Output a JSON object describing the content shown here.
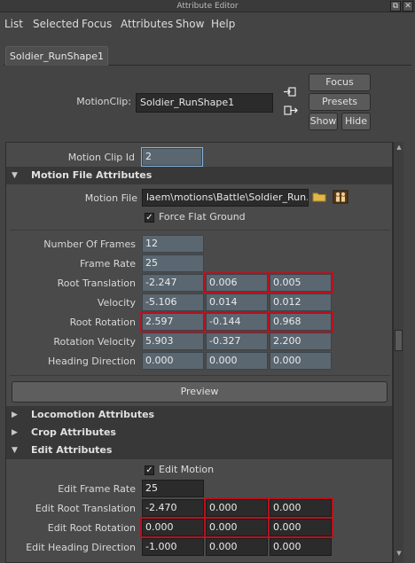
{
  "window": {
    "title": "Attribute Editor",
    "btn_restore": "⧉",
    "btn_close": "✕"
  },
  "menu": [
    "List",
    "Selected",
    "Focus",
    "Attributes",
    "Show",
    "Help"
  ],
  "tab": {
    "label": "Soldier_RunShape1"
  },
  "header": {
    "motionclip_label": "MotionClip:",
    "motionclip_value": "Soldier_RunShape1",
    "focus_btn": "Focus",
    "presets_btn": "Presets",
    "show_btn": "Show",
    "hide_btn": "Hide"
  },
  "clip_id": {
    "label": "Motion Clip Id",
    "value": "2"
  },
  "motion_file_section": {
    "title": "Motion File Attributes",
    "file_label": "Motion File",
    "file_value": "laem\\motions\\Battle\\Soldier_Run.gmo",
    "force_flat_label": "Force Flat Ground"
  },
  "attrs": {
    "num_frames": {
      "label": "Number Of Frames",
      "value": "12"
    },
    "frame_rate": {
      "label": "Frame Rate",
      "value": "25"
    },
    "root_translation": {
      "label": "Root Translation",
      "x": "-2.247",
      "y": "0.006",
      "z": "0.005"
    },
    "velocity": {
      "label": "Velocity",
      "x": "-5.106",
      "y": "0.014",
      "z": "0.012"
    },
    "root_rotation": {
      "label": "Root Rotation",
      "x": "2.597",
      "y": "-0.144",
      "z": "0.968"
    },
    "rotation_velocity": {
      "label": "Rotation Velocity",
      "x": "5.903",
      "y": "-0.327",
      "z": "2.200"
    },
    "heading_direction": {
      "label": "Heading Direction",
      "x": "0.000",
      "y": "0.000",
      "z": "0.000"
    }
  },
  "preview_btn": "Preview",
  "sections": {
    "locomotion": "Locomotion Attributes",
    "crop": "Crop Attributes",
    "edit": "Edit Attributes"
  },
  "edit": {
    "edit_motion_label": "Edit Motion",
    "edit_frame_rate": {
      "label": "Edit Frame Rate",
      "value": "25"
    },
    "edit_root_translation": {
      "label": "Edit Root Translation",
      "x": "-2.470",
      "y": "0.000",
      "z": "0.000"
    },
    "edit_root_rotation": {
      "label": "Edit Root Rotation",
      "x": "0.000",
      "y": "0.000",
      "z": "0.000"
    },
    "edit_heading_direction": {
      "label": "Edit Heading Direction",
      "x": "-1.000",
      "y": "0.000",
      "z": "0.000"
    }
  },
  "icons": {
    "expanded": "▼",
    "collapsed": "▶",
    "check": "✓",
    "folder": "folder-icon",
    "people": "people-icon",
    "input_connection": "input-connection-icon",
    "output_connection": "output-connection-icon"
  },
  "colors": {
    "highlight": "#b8121e",
    "numeric_field": "#5a6670",
    "panel": "#4a4a4a"
  }
}
